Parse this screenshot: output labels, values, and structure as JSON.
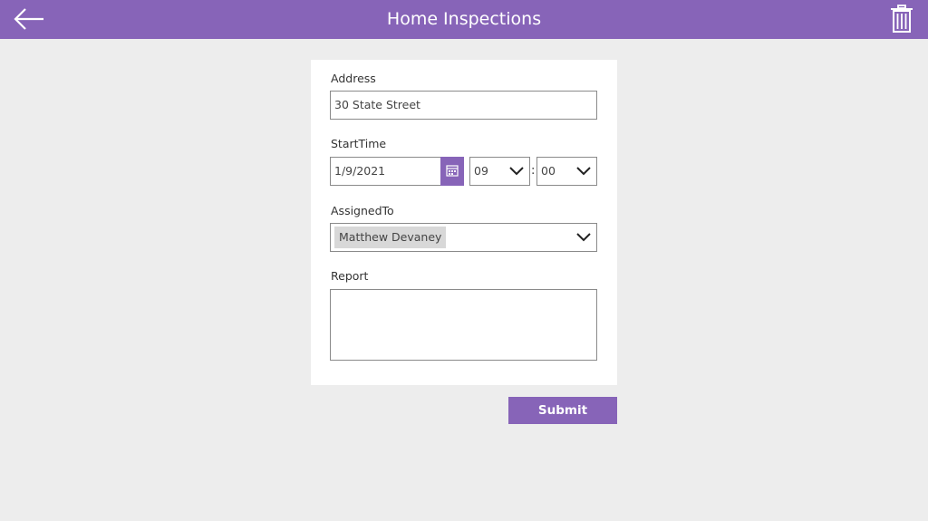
{
  "header": {
    "title": "Home Inspections",
    "back_icon": "arrow-left-icon",
    "trash_icon": "trash-icon",
    "color": "#8764b8"
  },
  "form": {
    "address": {
      "label": "Address",
      "value": "30 State Street"
    },
    "start_time": {
      "label": "StartTime",
      "date": "1/9/2021",
      "calendar_icon": "calendar-icon",
      "hour": "09",
      "separator": ":",
      "minute": "00"
    },
    "assigned_to": {
      "label": "AssignedTo",
      "value": "Matthew Devaney"
    },
    "report": {
      "label": "Report",
      "value": ""
    }
  },
  "actions": {
    "submit_label": "Submit"
  }
}
